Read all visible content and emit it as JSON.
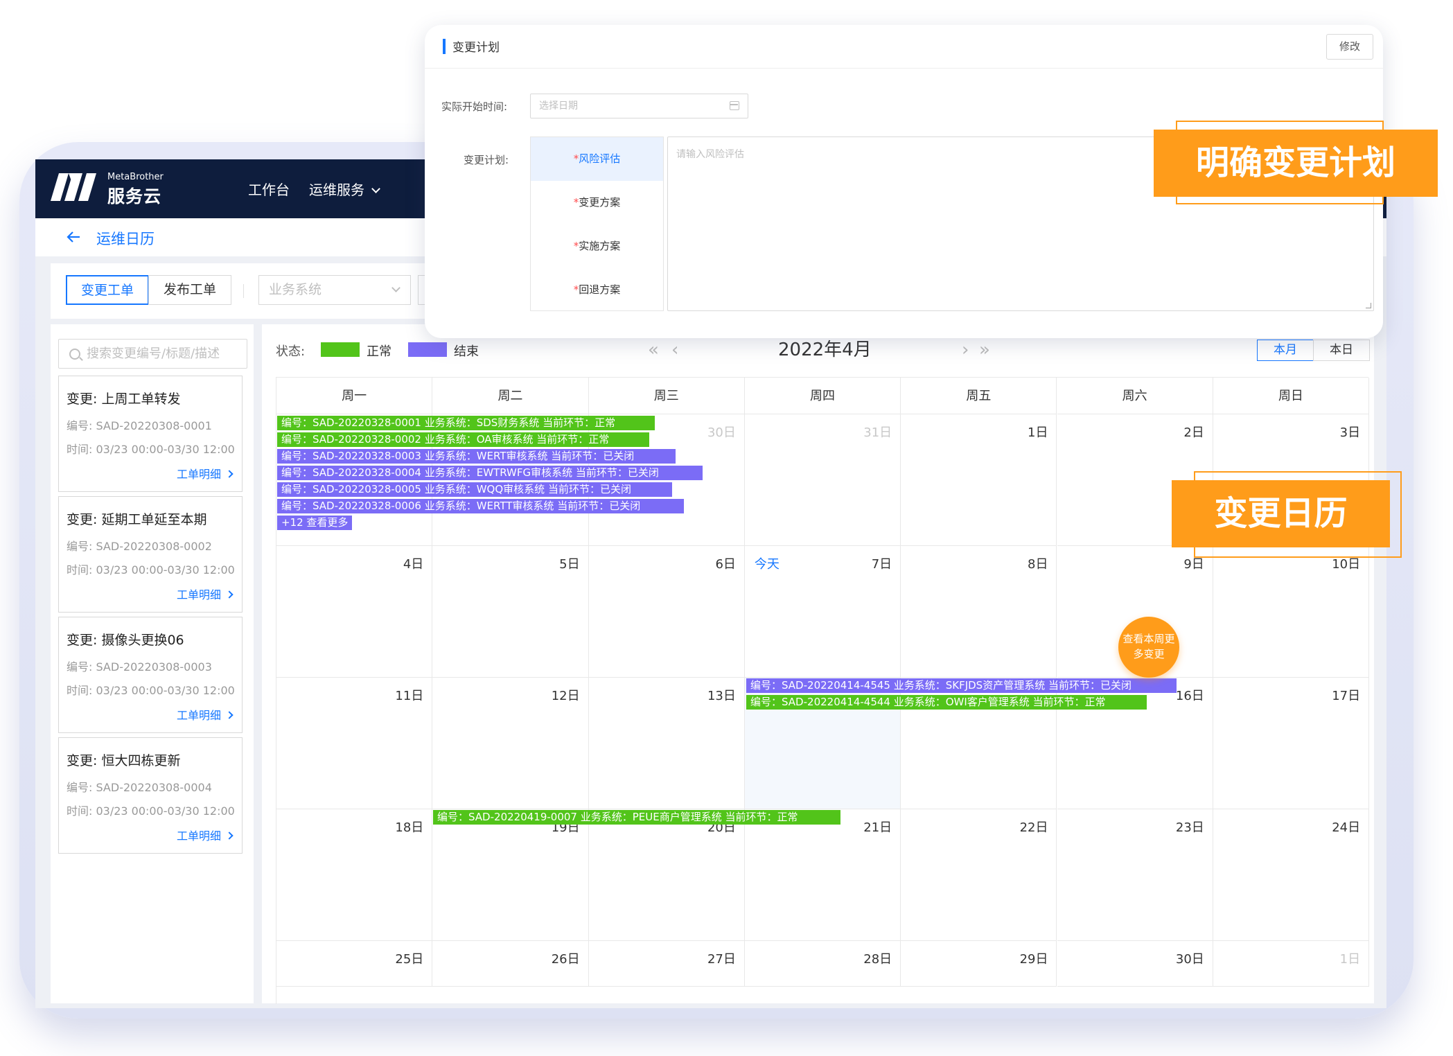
{
  "header": {
    "logo_en": "MetaBrother",
    "logo_cn": "服务云",
    "nav": [
      {
        "label": "工作台"
      },
      {
        "label": "运维服务"
      }
    ]
  },
  "breadcrumb": {
    "title": "运维日历"
  },
  "filters": {
    "tabs": [
      {
        "label": "变更工单"
      },
      {
        "label": "发布工单"
      }
    ],
    "business_select_placeholder": "业务系统"
  },
  "sidebar": {
    "search_placeholder": "搜索变更编号/标题/描述",
    "cards": [
      {
        "title": "变更: 上周工单转发",
        "code": "编号: SAD-20220308-0001",
        "time": "时间: 03/23 00:00-03/30 12:00",
        "link": "工单明细"
      },
      {
        "title": "变更: 延期工单延至本期",
        "code": "编号: SAD-20220308-0002",
        "time": "时间: 03/23 00:00-03/30 12:00",
        "link": "工单明细"
      },
      {
        "title": "变更: 摄像头更换06",
        "code": "编号: SAD-20220308-0003",
        "time": "时间: 03/23 00:00-03/30 12:00",
        "link": "工单明细"
      },
      {
        "title": "变更: 恒大四栋更新",
        "code": "编号: SAD-20220308-0004",
        "time": "时间: 03/23 00:00-03/30 12:00",
        "link": "工单明细"
      }
    ]
  },
  "calendar": {
    "status_label": "状态:",
    "legend": [
      {
        "label": "正常",
        "color": "#52c41a"
      },
      {
        "label": "结束",
        "color": "#7b6cf6"
      }
    ],
    "month_title": "2022年4月",
    "prev_year": "«",
    "prev_month": "‹",
    "next_month": "›",
    "next_year": "»",
    "view_buttons": [
      {
        "label": "本月"
      },
      {
        "label": "本日"
      }
    ],
    "weekdays": [
      "周一",
      "周二",
      "周三",
      "周四",
      "周五",
      "周六",
      "周日"
    ],
    "today_label": "今天",
    "weeks": [
      [
        "",
        "",
        "30日",
        "31日",
        "1日",
        "2日",
        "3日"
      ],
      [
        "4日",
        "5日",
        "6日",
        "7日",
        "8日",
        "9日",
        "10日"
      ],
      [
        "11日",
        "12日",
        "13日",
        "",
        "",
        "16日",
        "17日"
      ],
      [
        "18日",
        "19日",
        "20日",
        "21日",
        "22日",
        "23日",
        "24日"
      ],
      [
        "25日",
        "26日",
        "27日",
        "28日",
        "29日",
        "30日",
        "1日"
      ]
    ],
    "events": [
      {
        "text": "编号：SAD-20220328-0001  业务系统：SDS财务系统  当前环节：正常",
        "status": "normal"
      },
      {
        "text": "编号：SAD-20220328-0002  业务系统：OA审核系统  当前环节：正常",
        "status": "normal"
      },
      {
        "text": "编号：SAD-20220328-0003  业务系统：WERT审核系统  当前环节：已关闭",
        "status": "closed"
      },
      {
        "text": "编号：SAD-20220328-0004  业务系统：EWTRWFG审核系统  当前环节：已关闭",
        "status": "closed"
      },
      {
        "text": "编号：SAD-20220328-0005  业务系统：WQQ审核系统  当前环节：已关闭",
        "status": "closed"
      },
      {
        "text": "编号：SAD-20220328-0006  业务系统：WERTT审核系统  当前环节：已关闭",
        "status": "closed"
      },
      {
        "text": "+12 查看更多",
        "status": "closed"
      },
      {
        "text": "编号：SAD-20220414-4545  业务系统：SKFJDS资产管理系统  当前环节：已关闭",
        "status": "closed"
      },
      {
        "text": "编号：SAD-20220414-4544  业务系统：OWI客户管理系统  当前环节：正常",
        "status": "normal"
      },
      {
        "text": "编号：SAD-20220419-0007  业务系统：PEUE商户管理系统  当前环节：正常",
        "status": "normal"
      }
    ],
    "more_week_button": "查看本周更多变更"
  },
  "popup": {
    "title": "变更计划",
    "edit_button": "修改",
    "start_time_label": "实际开始时间:",
    "date_placeholder": "选择日期",
    "plan_label": "变更计划:",
    "tabs": [
      "风险评估",
      "变更方案",
      "实施方案",
      "回退方案"
    ],
    "textarea_placeholder": "请输入风险评估"
  },
  "callouts": {
    "plan": "明确变更计划",
    "calendar": "变更日历"
  }
}
